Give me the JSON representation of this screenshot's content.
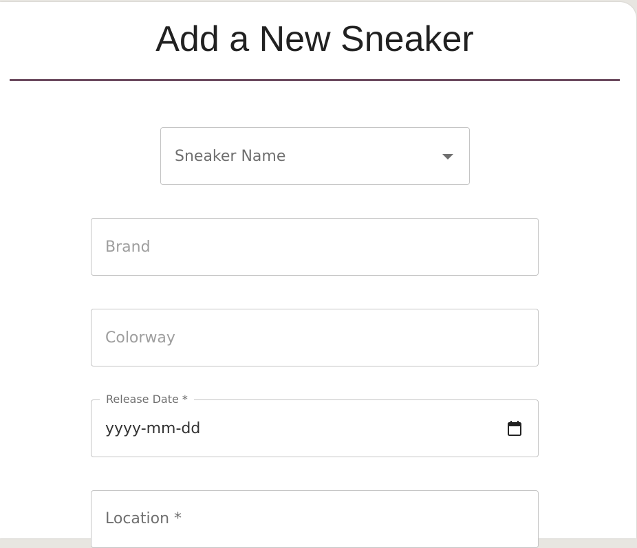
{
  "form": {
    "title": "Add a New Sneaker",
    "sneaker_name": {
      "placeholder": "Sneaker Name"
    },
    "brand": {
      "placeholder": "Brand"
    },
    "colorway": {
      "placeholder": "Colorway"
    },
    "release_date": {
      "label": "Release Date *",
      "value": "yyyy-mm-dd",
      "icon": "calendar-icon"
    },
    "location": {
      "placeholder": "Location *"
    }
  },
  "colors": {
    "divider": "#6b4a5e",
    "border": "#c4c4c4",
    "page_bg": "#e8e6e1"
  }
}
